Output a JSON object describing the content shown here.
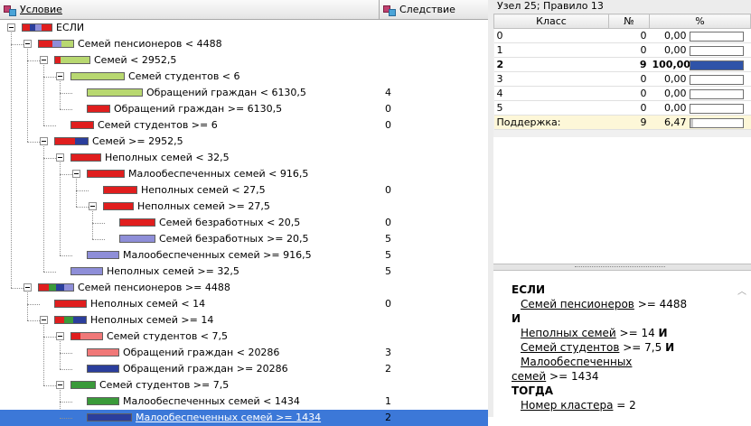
{
  "header": {
    "condition_label": "Условие",
    "consequence_label": "Следствие"
  },
  "colors": {
    "red": "#e01e1e",
    "blue": "#2b3e9c",
    "lilac": "#8e8ed8",
    "lime": "#b8d870",
    "green": "#3a9a3a",
    "pink": "#f07878",
    "selection": "#3c78d8"
  },
  "tree": [
    {
      "label": "ЕСЛИ",
      "cons": ""
    },
    {
      "label": "Семей пенсионеров < 4488",
      "cons": ""
    },
    {
      "label": "Семей < 2952,5",
      "cons": ""
    },
    {
      "label": "Семей студентов < 6",
      "cons": ""
    },
    {
      "label": "Обращений граждан < 6130,5",
      "cons": "4"
    },
    {
      "label": "Обращений граждан >= 6130,5",
      "cons": "0"
    },
    {
      "label": "Семей студентов >= 6",
      "cons": "0"
    },
    {
      "label": "Семей >= 2952,5",
      "cons": ""
    },
    {
      "label": "Неполных семей < 32,5",
      "cons": ""
    },
    {
      "label": "Малообеспеченных семей < 916,5",
      "cons": ""
    },
    {
      "label": "Неполных семей < 27,5",
      "cons": "0"
    },
    {
      "label": "Неполных семей >= 27,5",
      "cons": ""
    },
    {
      "label": "Семей безработных < 20,5",
      "cons": "0"
    },
    {
      "label": "Семей безработных >= 20,5",
      "cons": "5"
    },
    {
      "label": "Малообеспеченных семей >= 916,5",
      "cons": "5"
    },
    {
      "label": "Неполных семей >= 32,5",
      "cons": "5"
    },
    {
      "label": "Семей пенсионеров >= 4488",
      "cons": ""
    },
    {
      "label": "Неполных семей < 14",
      "cons": "0"
    },
    {
      "label": "Неполных семей >= 14",
      "cons": ""
    },
    {
      "label": "Семей студентов < 7,5",
      "cons": ""
    },
    {
      "label": "Обращений граждан < 20286",
      "cons": "3"
    },
    {
      "label": "Обращений граждан >= 20286",
      "cons": "2"
    },
    {
      "label": "Семей студентов >= 7,5",
      "cons": ""
    },
    {
      "label": "Малообеспеченных семей < 1434",
      "cons": "1"
    },
    {
      "label": "Малообеспеченных семей >= 1434",
      "cons": "2"
    }
  ],
  "node": {
    "title": "Узел 25; Правило 13",
    "col_class": "Класс",
    "col_n": "№",
    "col_pct": "%",
    "rows": [
      {
        "cls": "0",
        "n": "0",
        "pct": "0,00",
        "fill": 0
      },
      {
        "cls": "1",
        "n": "0",
        "pct": "0,00",
        "fill": 0
      },
      {
        "cls": "2",
        "n": "9",
        "pct": "100,00",
        "fill": 100
      },
      {
        "cls": "3",
        "n": "0",
        "pct": "0,00",
        "fill": 0
      },
      {
        "cls": "4",
        "n": "0",
        "pct": "0,00",
        "fill": 0
      },
      {
        "cls": "5",
        "n": "0",
        "pct": "0,00",
        "fill": 0
      }
    ],
    "support_label": "Поддержка:",
    "support_n": "9",
    "support_pct": "6,47",
    "support_fill": 6.47
  },
  "rule": {
    "if_kw": "ЕСЛИ",
    "c1": "Семей пенсионеров",
    "c1_rest": " >= 4488",
    "and_kw": "И",
    "c2": "Неполных семей",
    "c2_rest": " >= 14 ",
    "c3": "Семей студентов",
    "c3_rest": " >= 7,5 ",
    "c4a": "Малообеспеченных",
    "c4b": "семей",
    "c4_rest": " >= 1434",
    "then_kw": "ТОГДА",
    "c5": "Номер кластера",
    "c5_rest": " = 2"
  }
}
